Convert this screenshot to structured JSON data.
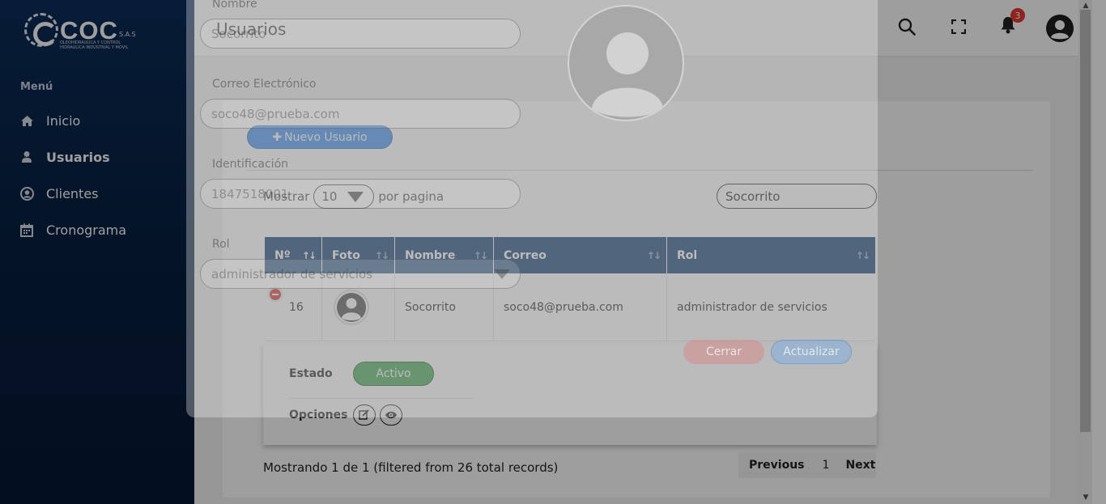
{
  "brand": {
    "logo_text": "COC",
    "logo_sas": "S.A.S",
    "logo_sub": "OLEOHIDRAULICA Y CONTROL HIDRAULICA INDUSTRIAL Y MOVIL"
  },
  "sidebar": {
    "menu_title": "Menú",
    "items": [
      {
        "label": "Inicio",
        "icon": "home-icon"
      },
      {
        "label": "Usuarios",
        "icon": "user-icon"
      },
      {
        "label": "Clientes",
        "icon": "user-circle-icon"
      },
      {
        "label": "Cronograma",
        "icon": "calendar-icon"
      }
    ]
  },
  "header": {
    "title": "Usuarios",
    "notification_count": "3"
  },
  "toolbar": {
    "new_user_label": "Nuevo Usuario"
  },
  "listing": {
    "show_label": "Mostrar",
    "page_size": "10",
    "per_page_label": "por pagina",
    "search_value": "Socorrito"
  },
  "table": {
    "headers": [
      "Nº",
      "Foto",
      "Nombre",
      "Correo",
      "Rol"
    ],
    "rows": [
      {
        "num": "16",
        "nombre": "Socorrito",
        "correo": "soco48@prueba.com",
        "rol": "administrador de servicios"
      }
    ]
  },
  "detail": {
    "estado_label": "Estado",
    "estado_value": "Activo",
    "opciones_label": "Opciones"
  },
  "footer": {
    "showing_text": "Mostrando 1 de 1 (filtered from 26 total records)",
    "prev": "Previous",
    "page": "1",
    "next": "Next"
  },
  "modal": {
    "nombre_label": "Nombre",
    "nombre_value": "Socorrito",
    "correo_label": "Correo Electrónico",
    "correo_value": "soco48@prueba.com",
    "id_label": "Identificación",
    "id_value": "1847518001",
    "rol_label": "Rol",
    "rol_value": "administrador de servicios",
    "close_label": "Cerrar",
    "update_label": "Actualizar"
  },
  "colors": {
    "sidebar": "#0b2d58",
    "table_header": "#0c3a70",
    "primary": "#3d8ef0",
    "success": "#3fa64f",
    "danger": "#d9342b"
  }
}
